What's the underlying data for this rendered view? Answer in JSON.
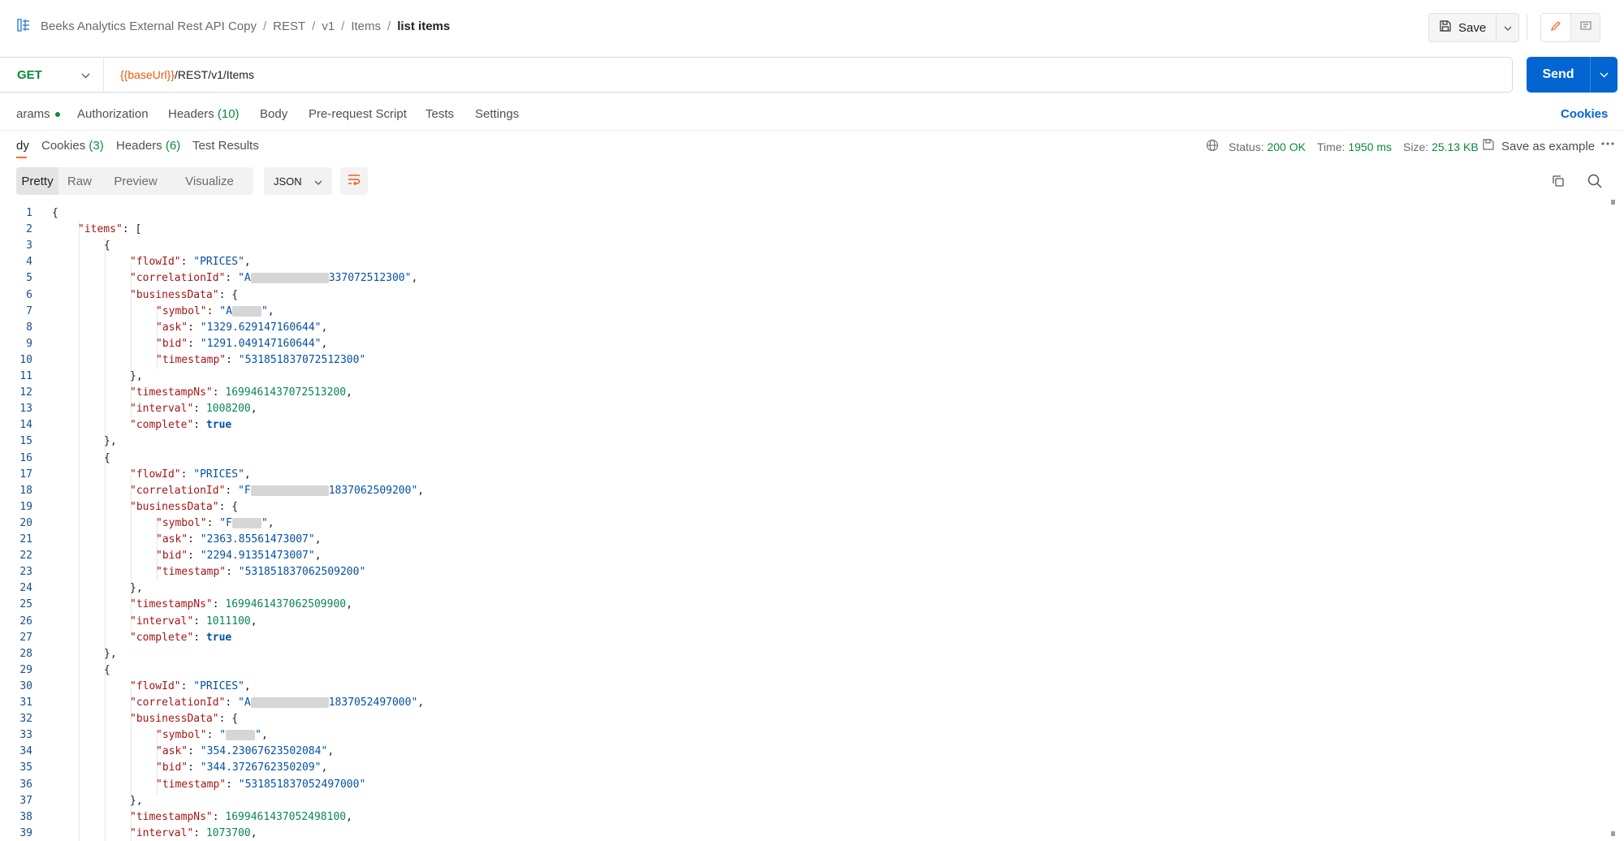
{
  "breadcrumb": {
    "items": [
      "Beeks Analytics External Rest API Copy",
      "REST",
      "v1",
      "Items"
    ],
    "current": "list items",
    "separator": "/"
  },
  "header": {
    "save_label": "Save"
  },
  "request": {
    "method": "GET",
    "url_variable": "{{baseUrl}}",
    "url_path": "/REST/v1/Items",
    "send_label": "Send"
  },
  "request_tabs": {
    "params": "arams",
    "authorization": "Authorization",
    "headers": "Headers",
    "headers_count": "(10)",
    "body": "Body",
    "pre_request": "Pre-request Script",
    "tests": "Tests",
    "settings": "Settings",
    "cookies_link": "Cookies"
  },
  "response_tabs": {
    "body": "dy",
    "cookies": "Cookies",
    "cookies_count": "(3)",
    "headers": "Headers",
    "headers_count": "(6)",
    "test_results": "Test Results"
  },
  "response_meta": {
    "status_label": "Status:",
    "status_value": "200 OK",
    "time_label": "Time:",
    "time_value": "1950 ms",
    "size_label": "Size:",
    "size_value": "25.13 KB",
    "save_example": "Save as example"
  },
  "view_toolbar": {
    "options": [
      "Pretty",
      "Raw",
      "Preview",
      "Visualize"
    ],
    "active": "Pretty",
    "format": "JSON"
  },
  "colors": {
    "accent_blue": "#0265d2",
    "method_green": "#0b8a3e",
    "variable_orange": "#e8590c",
    "tab_underline": "#ff6c37"
  },
  "code_lines": [
    {
      "n": "1",
      "text": "{"
    },
    {
      "n": "2",
      "text": "\"items\": ["
    },
    {
      "n": "3",
      "text": "{"
    },
    {
      "n": "4",
      "text": "\"flowId\": \"PRICES\","
    },
    {
      "n": "5",
      "text": "\"correlationId\": \"A 337072512300\","
    },
    {
      "n": "6",
      "text": "\"businessData\": {"
    },
    {
      "n": "7",
      "text": "\"symbol\": \"A \","
    },
    {
      "n": "8",
      "text": "\"ask\": \"1329.629147160644\","
    },
    {
      "n": "9",
      "text": "\"bid\": \"1291.049147160644\","
    },
    {
      "n": "10",
      "text": "\"timestamp\": \"531851837072512300\""
    },
    {
      "n": "11",
      "text": "},"
    },
    {
      "n": "12",
      "text": "\"timestampNs\": 1699461437072513200,"
    },
    {
      "n": "13",
      "text": "\"interval\": 1008200,"
    },
    {
      "n": "14",
      "text": "\"complete\": true"
    },
    {
      "n": "15",
      "text": "},"
    },
    {
      "n": "16",
      "text": "{"
    },
    {
      "n": "17",
      "text": "\"flowId\": \"PRICES\","
    },
    {
      "n": "18",
      "text": "\"correlationId\": \"F 1837062509200\","
    },
    {
      "n": "19",
      "text": "\"businessData\": {"
    },
    {
      "n": "20",
      "text": "\"symbol\": \"F \","
    },
    {
      "n": "21",
      "text": "\"ask\": \"2363.85561473007\","
    },
    {
      "n": "22",
      "text": "\"bid\": \"2294.91351473007\","
    },
    {
      "n": "23",
      "text": "\"timestamp\": \"531851837062509200\""
    },
    {
      "n": "24",
      "text": "},"
    },
    {
      "n": "25",
      "text": "\"timestampNs\": 1699461437062509900,"
    },
    {
      "n": "26",
      "text": "\"interval\": 1011100,"
    },
    {
      "n": "27",
      "text": "\"complete\": true"
    },
    {
      "n": "28",
      "text": "},"
    },
    {
      "n": "29",
      "text": "{"
    },
    {
      "n": "30",
      "text": "\"flowId\": \"PRICES\","
    },
    {
      "n": "31",
      "text": "\"correlationId\": \"A 1837052497000\","
    },
    {
      "n": "32",
      "text": "\"businessData\": {"
    },
    {
      "n": "33",
      "text": "\"symbol\": \" \","
    },
    {
      "n": "34",
      "text": "\"ask\": \"354.23067623502084\","
    },
    {
      "n": "35",
      "text": "\"bid\": \"344.3726762350209\","
    },
    {
      "n": "36",
      "text": "\"timestamp\": \"531851837052497000\""
    },
    {
      "n": "37",
      "text": "},"
    },
    {
      "n": "38",
      "text": "\"timestampNs\": 1699461437052498100,"
    },
    {
      "n": "39",
      "text": "\"interval\": 1073700,"
    }
  ]
}
